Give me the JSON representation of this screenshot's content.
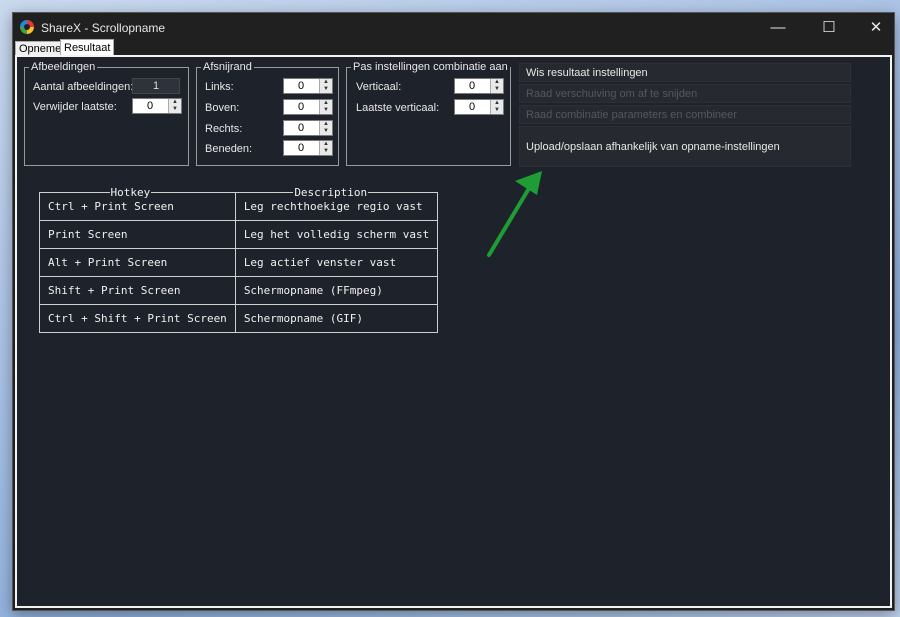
{
  "window": {
    "title": "ShareX - Scrollopname",
    "minimize_glyph": "—",
    "maximize_glyph": "☐",
    "close_glyph": "✕"
  },
  "tabs": [
    {
      "label": "Opnemen",
      "active": false
    },
    {
      "label": "Resultaat",
      "active": true
    }
  ],
  "afbeeldingen": {
    "title": "Afbeeldingen",
    "count_label": "Aantal afbeeldingen:",
    "count_value": "1",
    "remove_last_label": "Verwijder laatste:",
    "remove_last_value": "0"
  },
  "afsnijrand": {
    "title": "Afsnijrand",
    "fields": [
      {
        "label": "Links:",
        "value": "0"
      },
      {
        "label": "Boven:",
        "value": "0"
      },
      {
        "label": "Rechts:",
        "value": "0"
      },
      {
        "label": "Beneden:",
        "value": "0"
      }
    ]
  },
  "combinatie": {
    "title": "Pas instellingen combinatie aan",
    "fields": [
      {
        "label": "Verticaal:",
        "value": "0"
      },
      {
        "label": "Laatste verticaal:",
        "value": "0"
      }
    ]
  },
  "actions": [
    {
      "label": "Wis resultaat instellingen",
      "enabled": true
    },
    {
      "label": "Raad verschuiving om af te snijden",
      "enabled": false
    },
    {
      "label": "Raad combinatie parameters en combineer",
      "enabled": false
    },
    {
      "label": "Upload/opslaan afhankelijk van opname-instellingen",
      "enabled": true
    }
  ],
  "hotkeys": {
    "headers": [
      "Hotkey",
      "Description"
    ],
    "rows": [
      [
        "Ctrl + Print Screen",
        "Leg rechthoekige regio vast"
      ],
      [
        "Print Screen",
        "Leg het volledig scherm vast"
      ],
      [
        "Alt + Print Screen",
        "Leg actief venster vast"
      ],
      [
        "Shift + Print Screen",
        "Schermopname (FFmpeg)"
      ],
      [
        "Ctrl + Shift + Print Screen",
        "Schermopname (GIF)"
      ]
    ]
  },
  "colors": {
    "content_bg": "#1e222a",
    "arrow": "#1f9d35"
  },
  "icons": {
    "app": "sharex-icon",
    "annotation": "green-arrow-icon"
  }
}
